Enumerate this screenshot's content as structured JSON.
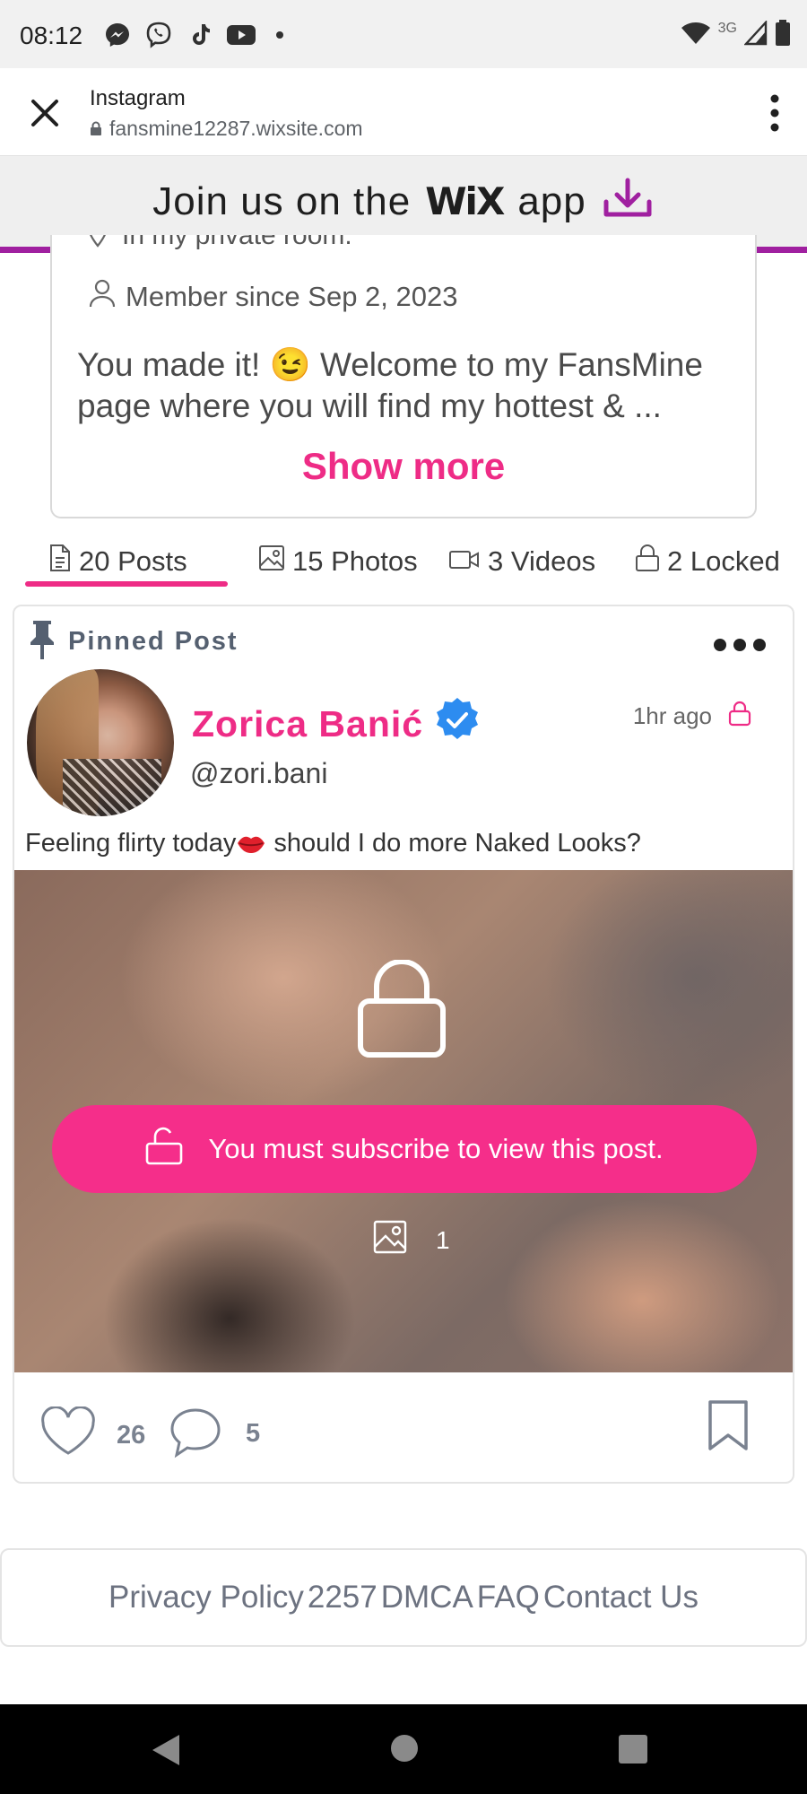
{
  "status_bar": {
    "time": "08:12",
    "network": "3G",
    "icons": [
      "messenger-icon",
      "viber-icon",
      "tiktok-icon",
      "youtube-icon",
      "wifi-icon",
      "signal-icon",
      "battery-icon"
    ]
  },
  "browser": {
    "title": "Instagram",
    "url": "fansmine12287.wixsite.com"
  },
  "wix_banner": {
    "text_before": "Join us on the",
    "logo": "WiX",
    "text_after": "app",
    "accent_color": "#a020a0"
  },
  "profile": {
    "location_partial": "In my private room.",
    "member_since": "Member since Sep 2, 2023",
    "bio": "You made it! 😉 Welcome to my FansMine page where you will find my hottest & ...",
    "show_more": "Show more"
  },
  "tabs": [
    {
      "label": "20 Posts",
      "icon": "document-icon",
      "active": true
    },
    {
      "label": "15 Photos",
      "icon": "image-icon",
      "active": false
    },
    {
      "label": "3 Videos",
      "icon": "video-icon",
      "active": false
    },
    {
      "label": "2 Locked",
      "icon": "lock-icon",
      "active": false
    }
  ],
  "post": {
    "pinned_label": "Pinned Post",
    "author_name": "Zorica Banić",
    "verified": true,
    "handle": "@zori.bani",
    "time": "1hr ago",
    "caption": "Feeling flirty today",
    "caption_rest": " should I do more Naked Looks?",
    "subscribe_text": "You must subscribe to view this post.",
    "media_count": "1",
    "likes": "26",
    "comments": "5"
  },
  "footer": {
    "links": [
      "Privacy Policy",
      "2257",
      "DMCA",
      "FAQ",
      "Contact Us"
    ]
  },
  "colors": {
    "brand_pink": "#ee2c86",
    "button_pink": "#f52e8a",
    "wix_purple": "#a020a0",
    "verified_blue": "#2d8cf0"
  }
}
